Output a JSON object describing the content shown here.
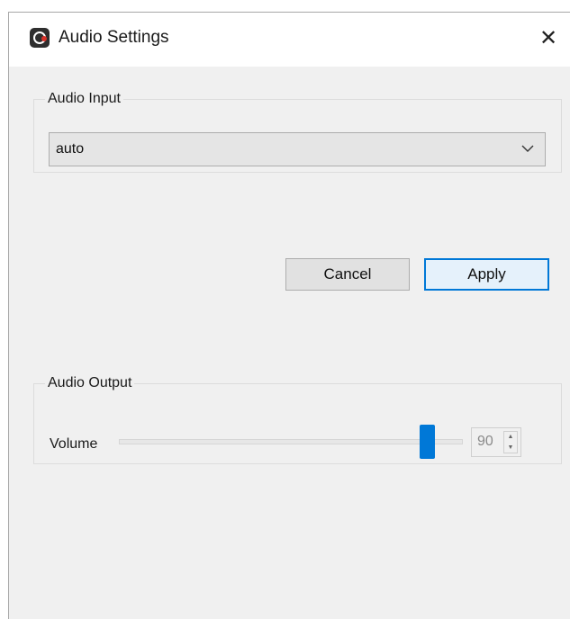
{
  "window": {
    "title": "Audio Settings",
    "close_glyph": "✕"
  },
  "audio_input": {
    "group_label": "Audio Input",
    "device_selected": "auto"
  },
  "buttons": {
    "cancel_label": "Cancel",
    "apply_label": "Apply"
  },
  "audio_output": {
    "group_label": "Audio Output",
    "volume_label": "Volume",
    "volume_value": "90",
    "volume_fraction": 0.9
  },
  "colors": {
    "accent": "#0078d7",
    "window_bg": "#f0f0f0"
  },
  "icons": [
    "app-logo-icon",
    "close-icon",
    "chevron-down-icon",
    "spin-up-icon",
    "spin-down-icon"
  ]
}
